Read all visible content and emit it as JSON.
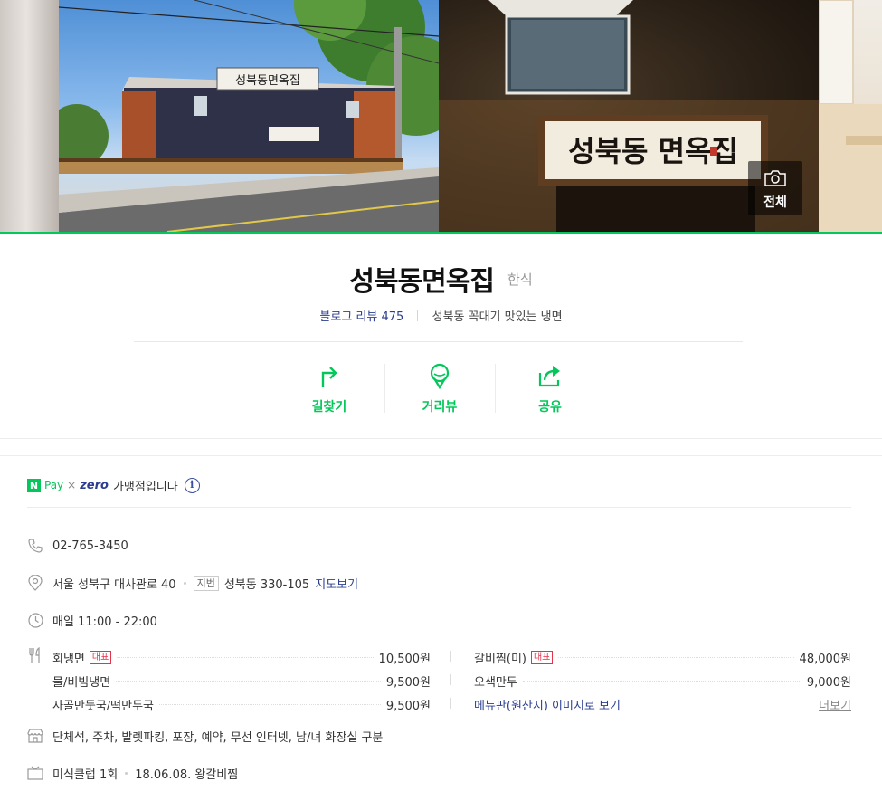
{
  "gallery": {
    "all_photos_label": "전체",
    "main_photo_sign_text": "성북동면옥집",
    "second_photo_sign_text": "성북동 면옥집"
  },
  "place": {
    "name": "성북동면옥집",
    "category": "한식",
    "blog_review_label": "블로그 리뷰",
    "blog_review_count": "475",
    "tagline": "성북동 꼭대기 맛있는 냉면"
  },
  "actions": [
    {
      "label": "길찾기",
      "icon": "directions-icon"
    },
    {
      "label": "거리뷰",
      "icon": "streetview-icon"
    },
    {
      "label": "공유",
      "icon": "share-icon"
    }
  ],
  "npay": {
    "badge": "N",
    "pay": "Pay",
    "x": "×",
    "zero": "zero",
    "desc": "가맹점입니다",
    "info": "i"
  },
  "info": {
    "phone": "02-765-3450",
    "address": "서울 성북구 대사관로 40",
    "jibun_badge": "지번",
    "jibun_address": "성북동 330-105",
    "map_link": "지도보기",
    "hours": "매일 11:00 - 22:00",
    "amenities": "단체석, 주차, 발렛파킹, 포장, 예약, 무선 인터넷, 남/녀 화장실 구분",
    "tv_show": "미식클럽 1회",
    "tv_date": "18.06.08. 왕갈비찜"
  },
  "menu": {
    "left": [
      {
        "name": "회냉면",
        "rep": "대표",
        "price": "10,500원"
      },
      {
        "name": "물/비빔냉면",
        "rep": "",
        "price": "9,500원"
      },
      {
        "name": "사골만둣국/떡만두국",
        "rep": "",
        "price": "9,500원"
      }
    ],
    "right": [
      {
        "name": "갈비찜(미)",
        "rep": "대표",
        "price": "48,000원"
      },
      {
        "name": "오색만두",
        "rep": "",
        "price": "9,000원"
      }
    ],
    "menu_board_link": "메뉴판(원산지) 이미지로 보기",
    "more_link": "더보기"
  },
  "colors": {
    "naver_green": "#03c75a",
    "link_blue": "#2b3e8f",
    "rep_red": "#e4334b"
  }
}
